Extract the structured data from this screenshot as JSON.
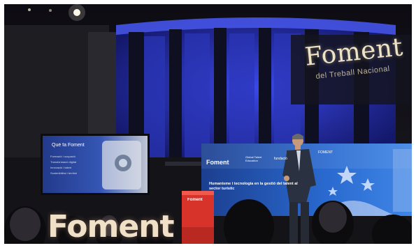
{
  "brand_sign": {
    "title": "Foment",
    "subtitle": "del Treball Nacional"
  },
  "left_screen": {
    "title": "Què fa Foment",
    "bullets": [
      "Formació i ocupació",
      "Transformació digital",
      "Innovació i talent",
      "Sostenibilitat i territori"
    ]
  },
  "right_screen": {
    "logo": "Foment",
    "logo2": "Global Talent Education",
    "logo3": "fundació",
    "logo4": "FOMENT",
    "headline": "Humanisme i tecnologia en la gestió del talent al sector turístic"
  },
  "podium": {
    "logo": "Foment"
  },
  "stage_letters": "Foment"
}
